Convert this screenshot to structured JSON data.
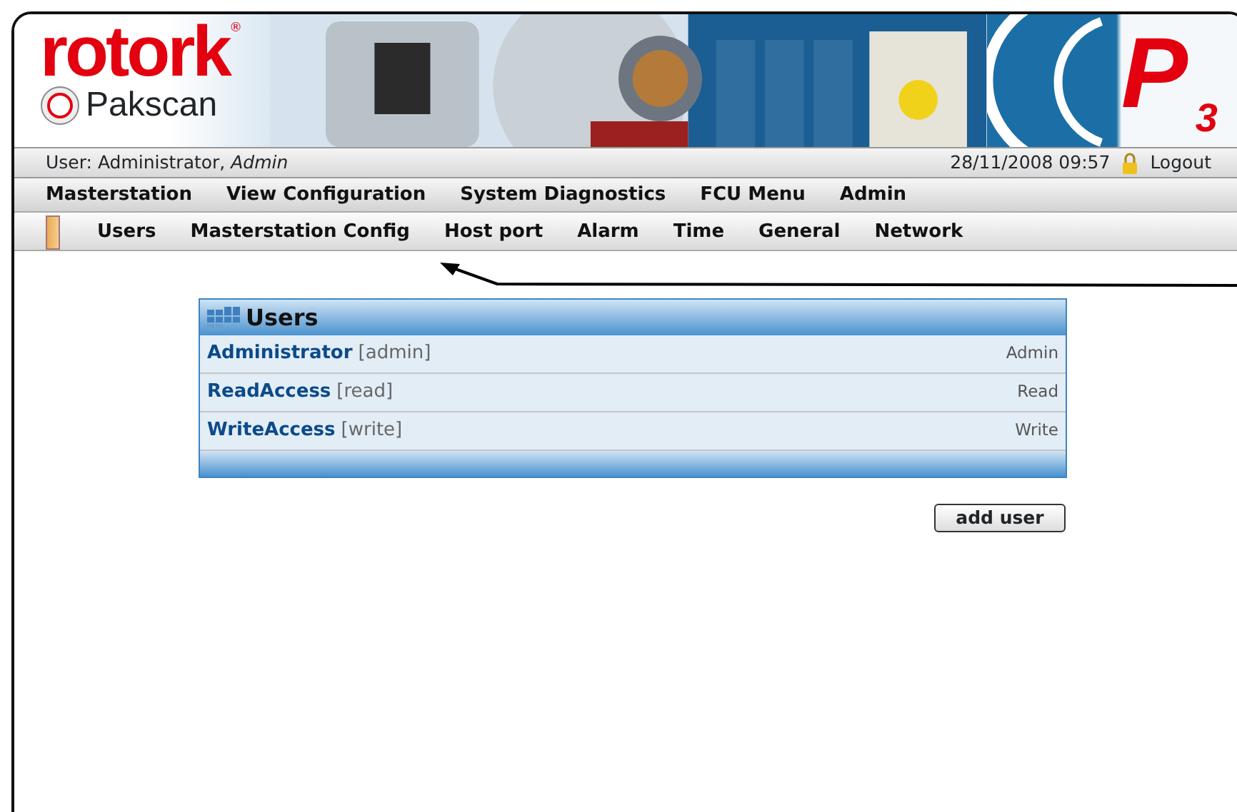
{
  "header": {
    "brand": "rotork",
    "registered": "®",
    "product": "Pakscan",
    "product_mark": "P",
    "product_mark_sub": "3"
  },
  "user_bar": {
    "user": "User: Administrator, *Admin*",
    "datetime": "28/11/2008 09:57",
    "logout": "Logout"
  },
  "main_menu": [
    {
      "label": "Masterstation"
    },
    {
      "label": "View Configuration"
    },
    {
      "label": "System Diagnostics"
    },
    {
      "label": "FCU Menu"
    },
    {
      "label": "Admin"
    }
  ],
  "sub_menu": [
    {
      "label": "Users",
      "selected": true
    },
    {
      "label": "Masterstation Config",
      "selected": false
    },
    {
      "label": "Host port",
      "selected": false
    },
    {
      "label": "Alarm",
      "selected": false
    },
    {
      "label": "Time",
      "selected": false
    },
    {
      "label": "General",
      "selected": false
    },
    {
      "label": "Network",
      "selected": false
    }
  ],
  "users_panel": {
    "title": "Users",
    "rows": [
      {
        "name": "Administrator",
        "login": "[admin]",
        "role": "Admin"
      },
      {
        "name": "ReadAccess",
        "login": "[read]",
        "role": "Read"
      },
      {
        "name": "WriteAccess",
        "login": "[write]",
        "role": "Write"
      }
    ]
  },
  "add_button": "add user"
}
